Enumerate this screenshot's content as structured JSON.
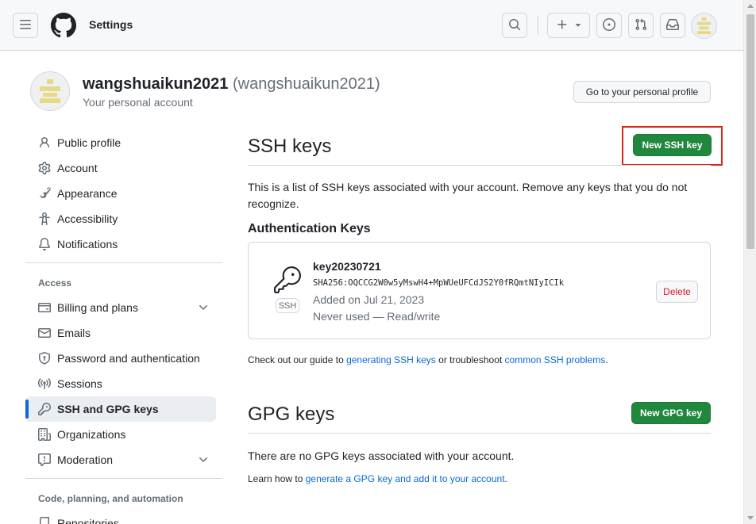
{
  "header": {
    "title": "Settings",
    "icons": [
      "menu-icon",
      "github-logo",
      "search-icon",
      "plus-icon",
      "triangle-down-icon",
      "issue-opened-icon",
      "git-pull-request-icon",
      "inbox-icon",
      "avatar"
    ]
  },
  "account": {
    "name": "wangshuaikun2021",
    "login": "(wangshuaikun2021)",
    "subtitle": "Your personal account",
    "profile_button": "Go to your personal profile"
  },
  "sidebar": {
    "items": [
      {
        "label": "Public profile",
        "icon": "person-icon"
      },
      {
        "label": "Account",
        "icon": "gear-icon"
      },
      {
        "label": "Appearance",
        "icon": "paintbrush-icon"
      },
      {
        "label": "Accessibility",
        "icon": "accessibility-icon"
      },
      {
        "label": "Notifications",
        "icon": "bell-icon"
      }
    ],
    "access_heading": "Access",
    "access_items": [
      {
        "label": "Billing and plans",
        "icon": "credit-card-icon",
        "expandable": true
      },
      {
        "label": "Emails",
        "icon": "mail-icon"
      },
      {
        "label": "Password and authentication",
        "icon": "shield-lock-icon"
      },
      {
        "label": "Sessions",
        "icon": "broadcast-icon"
      },
      {
        "label": "SSH and GPG keys",
        "icon": "key-icon",
        "selected": true
      },
      {
        "label": "Organizations",
        "icon": "organization-icon"
      },
      {
        "label": "Moderation",
        "icon": "report-icon",
        "expandable": true
      }
    ],
    "code_heading": "Code, planning, and automation",
    "code_items": [
      {
        "label": "Repositories",
        "icon": "repo-icon"
      }
    ]
  },
  "ssh": {
    "title": "SSH keys",
    "new_button": "New SSH key",
    "description": "This is a list of SSH keys associated with your account. Remove any keys that you do not recognize.",
    "auth_heading": "Authentication Keys",
    "key": {
      "title": "key20230721",
      "fingerprint": "SHA256:OQCCG2W0w5yMswH4+MpWUeUFCdJS2Y0fRQmtNIyICIk",
      "type_label": "SSH",
      "added": "Added on Jul 21, 2023",
      "usage": "Never used — Read/write",
      "delete_label": "Delete"
    },
    "guide_prefix": "Check out our guide to ",
    "guide_link1": "generating SSH keys",
    "guide_middle": " or troubleshoot ",
    "guide_link2": "common SSH problems",
    "guide_suffix": "."
  },
  "gpg": {
    "title": "GPG keys",
    "new_button": "New GPG key",
    "empty_text": "There are no GPG keys associated with your account.",
    "learn_prefix": "Learn how to ",
    "learn_link": "generate a GPG key and add it to your account",
    "learn_suffix": "."
  },
  "colors": {
    "accent": "#0969da",
    "primary_button": "#1f883d",
    "danger": "#cf222e",
    "highlight": "#e0251b"
  }
}
